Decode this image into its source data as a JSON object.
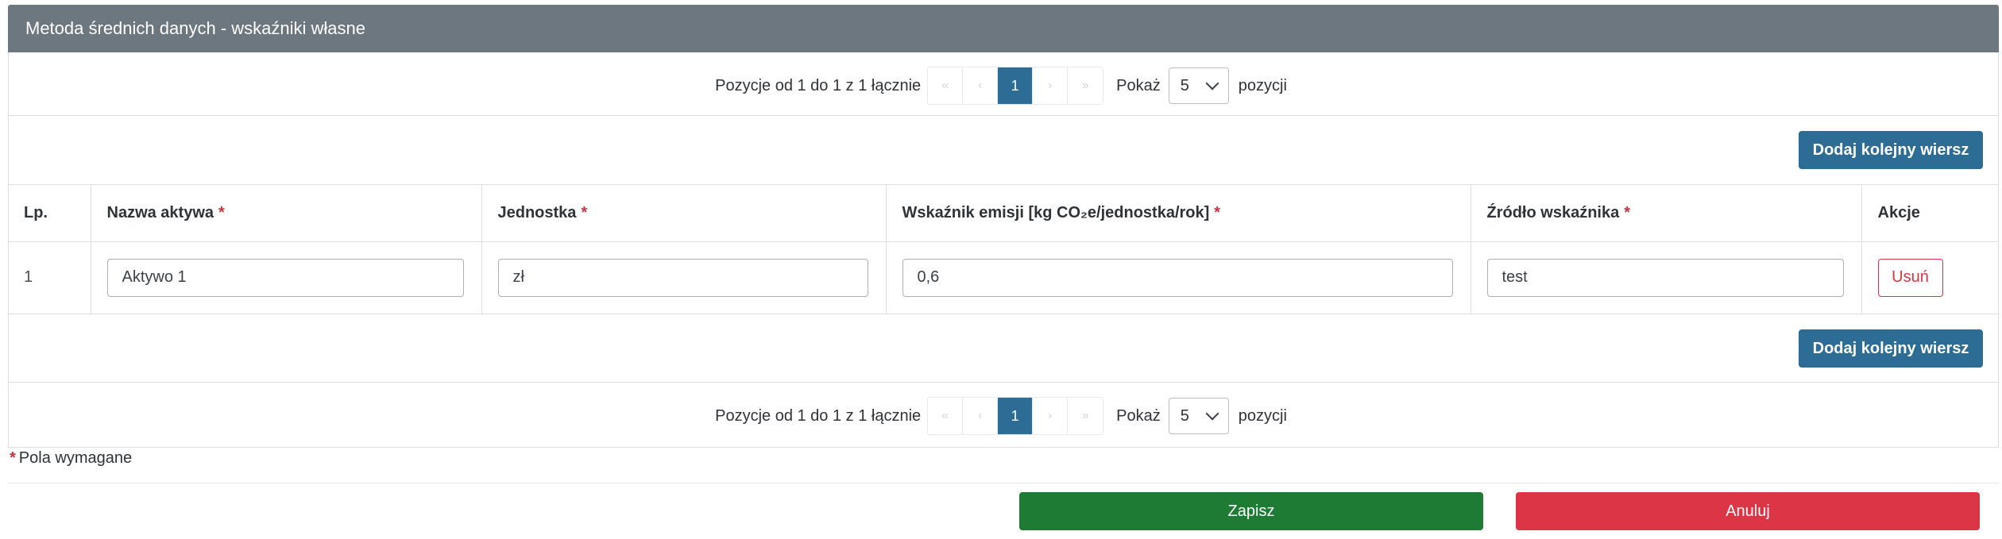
{
  "panel": {
    "title": "Metoda średnich danych - wskaźniki własne"
  },
  "pager": {
    "info": "Pozycje od 1 do 1 z 1 łącznie",
    "first": "«",
    "prev": "‹",
    "current_page": "1",
    "next": "›",
    "last": "»",
    "show_label": "Pokaż",
    "page_size": "5",
    "tail": "pozycji"
  },
  "actions": {
    "add_row": "Dodaj kolejny wiersz",
    "save": "Zapisz",
    "cancel": "Anuluj"
  },
  "table": {
    "headers": {
      "lp": "Lp.",
      "name": "Nazwa aktywa",
      "unit": "Jednostka",
      "factor": "Wskaźnik emisji [kg CO₂e/jednostka/rok]",
      "source": "Źródło wskaźnika",
      "actions": "Akcje"
    },
    "required_mark": "*",
    "rows": [
      {
        "lp": "1",
        "name": "Aktywo 1",
        "unit": "zł",
        "factor": "0,6",
        "source": "test",
        "delete": "Usuń"
      }
    ]
  },
  "footer": {
    "required_star": "*",
    "required_text": "Pola wymagane"
  },
  "colors": {
    "header_bg": "#6c777f",
    "primary": "#2c6c95",
    "success": "#1e7b34",
    "danger": "#dc3545"
  },
  "icons": {
    "select_toggle": "chevron-down-icon"
  }
}
